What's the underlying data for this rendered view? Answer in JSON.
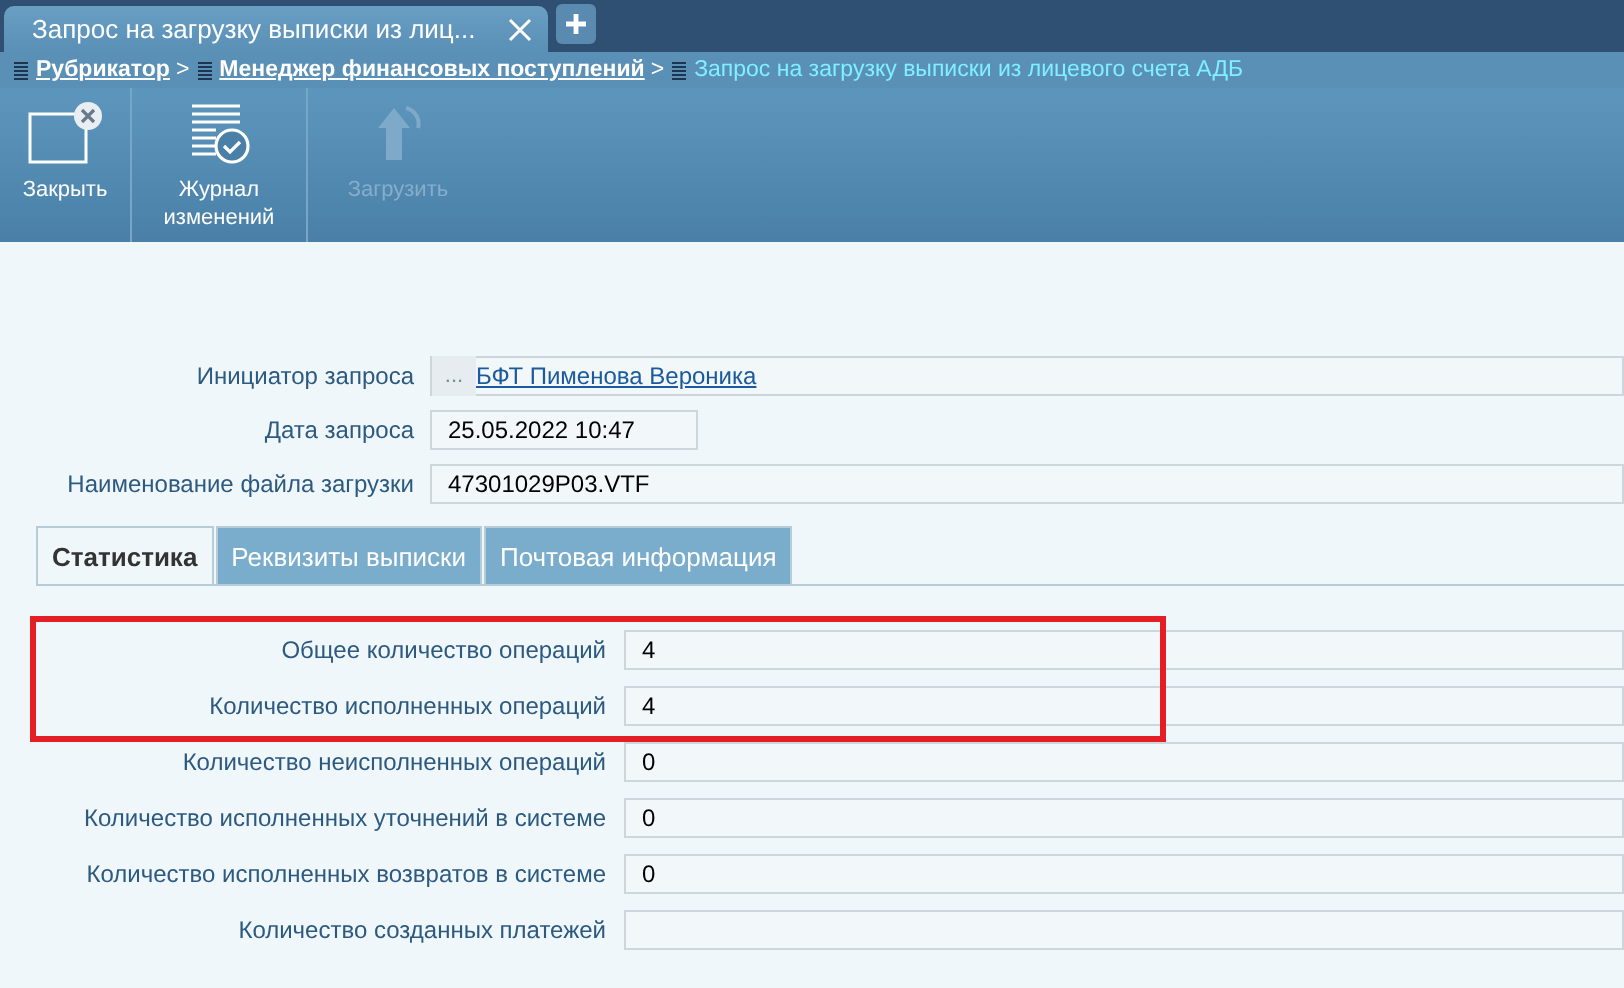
{
  "window_tabs": [
    {
      "title": "Запрос на загрузку выписки из лиц...",
      "selected": true
    }
  ],
  "breadcrumbs": [
    {
      "label": "Рубрикатор",
      "kind": "link"
    },
    {
      "label": "Менеджер финансовых поступлений",
      "kind": "link"
    },
    {
      "label": "Запрос на загрузку выписки из лицевого счета АДБ",
      "kind": "current"
    }
  ],
  "breadcrumb_separator": ">",
  "toolbar": [
    {
      "label": "Закрыть",
      "kind": "close",
      "disabled": false
    },
    {
      "label": "Журнал изменений",
      "kind": "log",
      "disabled": false
    },
    {
      "label": "Загрузить",
      "kind": "upload",
      "disabled": true
    }
  ],
  "form": [
    {
      "label": "Инициатор запроса",
      "value": "БФТ Пименова Вероника",
      "kind": "lookup",
      "button": "..."
    },
    {
      "label": "Дата запроса",
      "value": "25.05.2022 10:47",
      "kind": "short"
    },
    {
      "label": "Наименование файла загрузки",
      "value": "47301029P03.VTF",
      "kind": "wide"
    }
  ],
  "tabs": [
    {
      "label": "Статистика",
      "selected": true
    },
    {
      "label": "Реквизиты выписки",
      "selected": false
    },
    {
      "label": "Почтовая информация",
      "selected": false
    }
  ],
  "statistics": [
    {
      "label": "Общее количество операций",
      "value": "4",
      "highlighted": true
    },
    {
      "label": "Количество исполненных операций",
      "value": "4",
      "highlighted": true
    },
    {
      "label": "Количество неисполненных операций",
      "value": "0",
      "highlighted": false
    },
    {
      "label": "Количество исполненных уточнений в системе",
      "value": "0",
      "highlighted": false
    },
    {
      "label": "Количество исполненных возвратов в системе",
      "value": "0",
      "highlighted": false
    },
    {
      "label": "Количество созданных платежей",
      "highlighted": false
    }
  ]
}
